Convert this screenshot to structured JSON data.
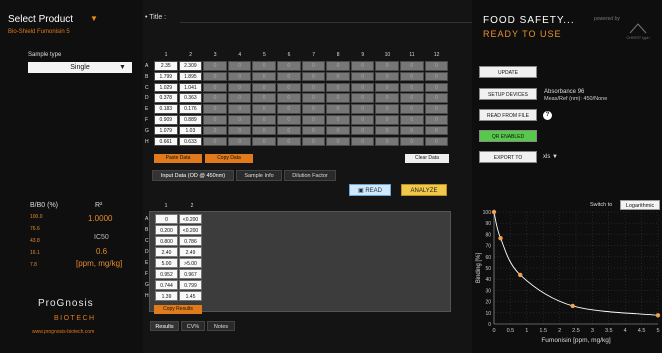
{
  "left": {
    "product_title": "Select Product",
    "product_caret": "▼",
    "product_name": "Bio-Shield Fumonisin 5",
    "sample_type_label": "Sample type",
    "sample_type_value": "Single",
    "sample_type_caret": "▼",
    "stats_header_b": "B/B0 (%)",
    "stats_header_r": "R²",
    "bb0_values": [
      "100.0",
      "76.6",
      "43.8",
      "16.1",
      "7.8"
    ],
    "r2_value": "1.0000",
    "ic50_label": "IC50",
    "ic50_value": "0.6",
    "ic50_units": "[ppm, mg/kg]",
    "logo_line1": "ProGnosis",
    "logo_line2": "BIOTECH",
    "logo_url": "www.prognosis-biotech.com"
  },
  "center": {
    "title_label": "• Title :",
    "col_numbers": [
      "1",
      "2",
      "3",
      "4",
      "5",
      "6",
      "7",
      "8",
      "9",
      "10",
      "11",
      "12"
    ],
    "row_letters": [
      "A",
      "B",
      "C",
      "D",
      "E",
      "F",
      "G",
      "H"
    ],
    "plate_values": [
      [
        "2.35",
        "2.309",
        "0",
        "0",
        "0",
        "0",
        "0",
        "0",
        "0",
        "0",
        "0",
        "0"
      ],
      [
        "1.799",
        "1.895",
        "0",
        "0",
        "0",
        "0",
        "0",
        "0",
        "0",
        "0",
        "0",
        "0"
      ],
      [
        "1.029",
        "1.041",
        "0",
        "0",
        "0",
        "0",
        "0",
        "0",
        "0",
        "0",
        "0",
        "0"
      ],
      [
        "0.378",
        "0.363",
        "0",
        "0",
        "0",
        "0",
        "0",
        "0",
        "0",
        "0",
        "0",
        "0"
      ],
      [
        "0.183",
        "0.176",
        "0",
        "0",
        "0",
        "0",
        "0",
        "0",
        "0",
        "0",
        "0",
        "0"
      ],
      [
        "0.909",
        "0.889",
        "0",
        "0",
        "0",
        "0",
        "0",
        "0",
        "0",
        "0",
        "0",
        "0"
      ],
      [
        "1.079",
        "1.03",
        "0",
        "0",
        "0",
        "0",
        "0",
        "0",
        "0",
        "0",
        "0",
        "0"
      ],
      [
        "0.661",
        "0.633",
        "0",
        "0",
        "0",
        "0",
        "0",
        "0",
        "0",
        "0",
        "0",
        "0"
      ]
    ],
    "paste_data": "Paste Data",
    "copy_data": "Copy Data",
    "clear_data": "Clear Data",
    "tabs": [
      "Input Data (OD @ 450nm)",
      "Sample Info",
      "Dilution Factor"
    ],
    "read_label": "READ",
    "analyze_label": "ANALYZE",
    "results_cols": [
      "1",
      "2"
    ],
    "results_values": [
      [
        "0",
        "<0.200"
      ],
      [
        "0.200",
        "<0.200"
      ],
      [
        "0.800",
        "0.786"
      ],
      [
        "2.40",
        "2.49"
      ],
      [
        "5.00",
        ">5.00"
      ],
      [
        "0.952",
        "0.967"
      ],
      [
        "0.744",
        "0.799"
      ],
      [
        "1.39",
        "1.45"
      ]
    ],
    "copy_results": "Copy Results",
    "result_tabs": [
      "Results",
      "CV%",
      "Notes"
    ]
  },
  "right": {
    "title": "FOOD SAFETY...",
    "subtitle": "READY TO USE",
    "powered_by": "powered by",
    "powered_logo": "CHRIST lyph",
    "buttons": [
      "UPDATE",
      "SETUP DEVICES",
      "READ FROM FILE",
      "QR ENABLED",
      "EXPORT TO"
    ],
    "absorbance_line": "Absorbance 96",
    "meas_line": "Meas/Ref (nm): 450/None",
    "help_icon": "?",
    "units_label": "xls  ▼",
    "switch_to": "Switch to",
    "log_button": "Logarithmic"
  },
  "colors": {
    "accent_orange": "#e07a1a",
    "qr_green": "#56c94a",
    "analyze_yellow": "#f2c84a",
    "read_blue": "#cfe8fa"
  },
  "chart_data": {
    "type": "scatter",
    "xlabel": "Fumonisin [ppm, mg/kg]",
    "ylabel": "Binding [%]",
    "xlim": [
      0,
      5
    ],
    "ylim": [
      0,
      100
    ],
    "x_ticks": [
      "0",
      "0.5",
      "1",
      "1.5",
      "2",
      "2.5",
      "3",
      "3.5",
      "4",
      "4.5",
      "5"
    ],
    "y_ticks": [
      "100",
      "90",
      "80",
      "70",
      "60",
      "50",
      "40",
      "30",
      "20",
      "10",
      "0"
    ],
    "points": [
      {
        "x": 0.0,
        "y": 100.0
      },
      {
        "x": 0.2,
        "y": 76.6
      },
      {
        "x": 0.8,
        "y": 43.8
      },
      {
        "x": 2.4,
        "y": 16.1
      },
      {
        "x": 5.0,
        "y": 7.8
      }
    ],
    "curve_color": "#ffffff",
    "point_color": "#f0a050"
  }
}
